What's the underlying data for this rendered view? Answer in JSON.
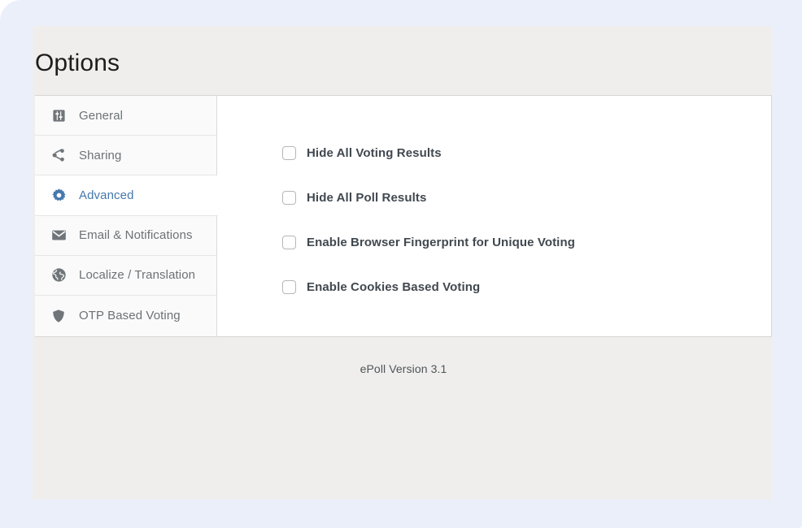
{
  "header": {
    "title": "Options"
  },
  "sidebar": {
    "items": [
      {
        "label": "General",
        "icon": "sliders-icon",
        "active": false
      },
      {
        "label": "Sharing",
        "icon": "share-icon",
        "active": false
      },
      {
        "label": "Advanced",
        "icon": "gear-icon",
        "active": true
      },
      {
        "label": "Email & Notifications",
        "icon": "envelope-icon",
        "active": false
      },
      {
        "label": "Localize / Translation",
        "icon": "globe-icon",
        "active": false
      },
      {
        "label": "OTP Based Voting",
        "icon": "shield-icon",
        "active": false
      }
    ]
  },
  "options": {
    "checkboxes": [
      {
        "label": "Hide All Voting Results",
        "checked": false
      },
      {
        "label": "Hide All Poll Results",
        "checked": false
      },
      {
        "label": "Enable Browser Fingerprint for Unique Voting",
        "checked": false
      },
      {
        "label": "Enable Cookies Based Voting",
        "checked": false
      }
    ]
  },
  "footer": {
    "version": "ePoll Version 3.1"
  },
  "colors": {
    "accent": "#4579ad",
    "page_background": "#eaeffa",
    "card_background": "#efeeed",
    "panel_background": "#ffffff",
    "sidebar_background": "#fafafa",
    "label_text": "#41484f",
    "muted_text": "#6d7275"
  }
}
